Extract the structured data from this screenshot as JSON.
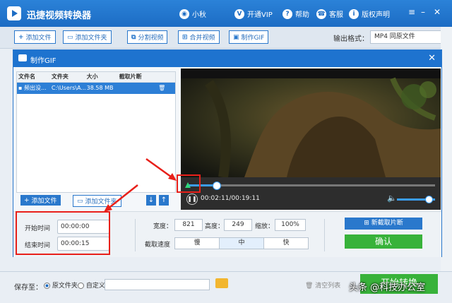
{
  "app": {
    "title": "迅捷视频转换器",
    "user": "小秋",
    "vip": "开通VIP",
    "help": "帮助",
    "service": "客服",
    "copyright": "版权声明"
  },
  "toolbar": {
    "add_file": "添加文件",
    "add_folder": "添加文件夹",
    "split_video": "分割视频",
    "merge_video": "合并视频",
    "make_gif": "制作GIF",
    "format_label": "输出格式：",
    "format_value": "MP4  同原文件"
  },
  "dialog": {
    "title": "制作GIF",
    "table": {
      "headers": [
        "文件名",
        "文件夹",
        "大小",
        "截取片断"
      ],
      "rows": [
        {
          "name": "频出没...",
          "folder": "C:\\Users\\A...",
          "size": "38.58 MB",
          "clip": ""
        }
      ]
    },
    "add_file": "添加文件",
    "add_folder": "添加文件夹",
    "player": {
      "time": "00:02:11/00:19:11",
      "progress": 0.114,
      "volume": 0.8
    },
    "start_label": "开始时间",
    "start_value": "00:00:00",
    "end_label": "结束时间",
    "end_value": "00:00:15",
    "width_label": "宽度：",
    "width_value": "821",
    "height_label": "高度：",
    "height_value": "249",
    "scale_label": "缩放：",
    "scale_value": "100%",
    "speed_label": "截取速度",
    "speeds": [
      "慢",
      "中",
      "快"
    ],
    "selected_speed": "中",
    "new_clip": "新截取片断",
    "confirm": "确认"
  },
  "save": {
    "label": "保存至：",
    "option_original": "原文件夹",
    "option_custom": "自定义",
    "clear": "清空列表",
    "start": "开始转换"
  },
  "watermark": "头条 @科技办公室",
  "colors": {
    "primary": "#1e73cf",
    "accent_green": "#38b23a",
    "highlight_red": "#e8201a"
  }
}
